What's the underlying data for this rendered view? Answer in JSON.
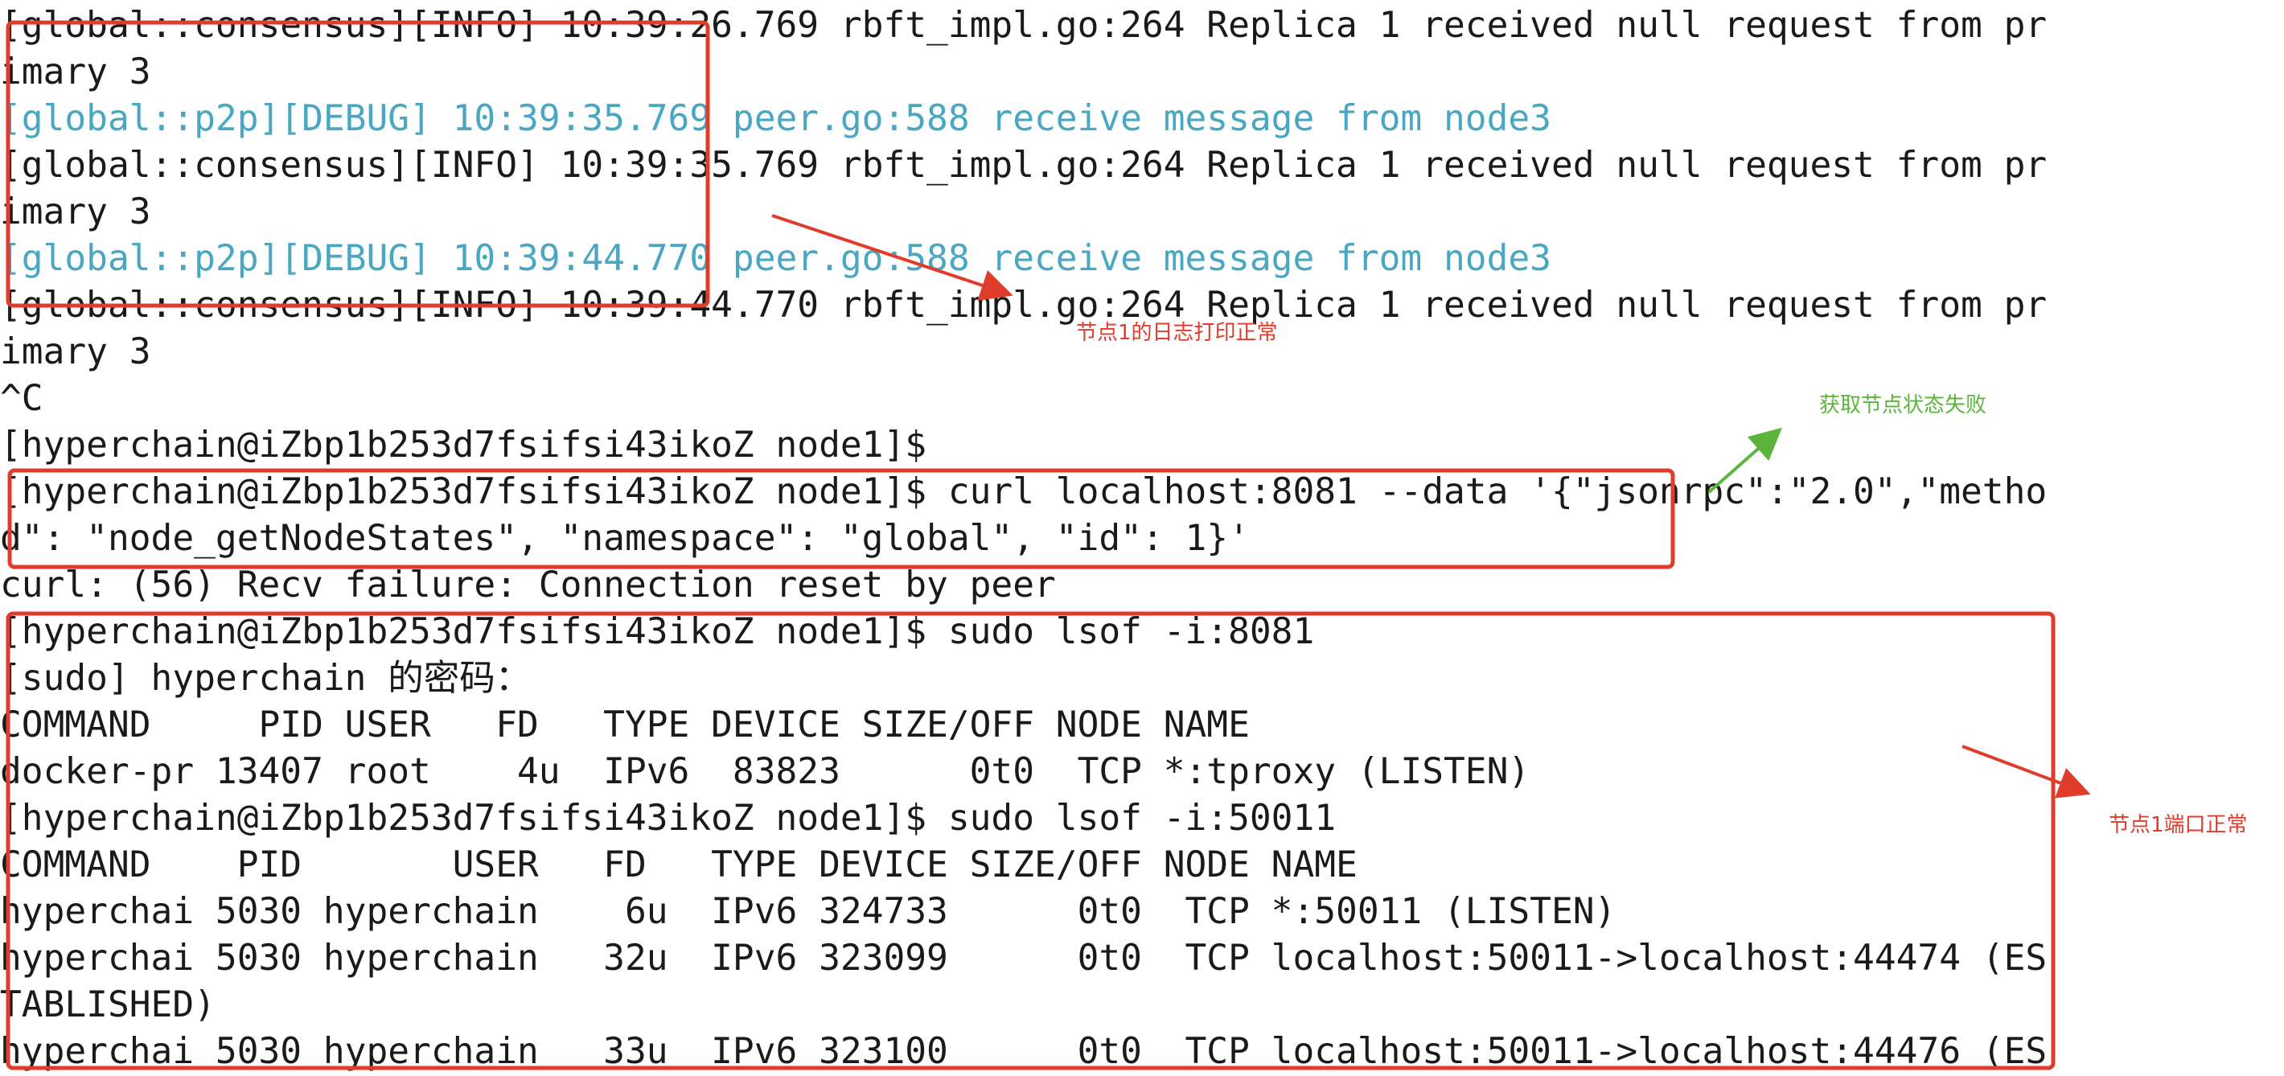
{
  "terminal": {
    "lines": [
      {
        "text": "[global::consensus][INFO] 10:39:26.769 rbft_impl.go:264 Replica 1 received null request from pr",
        "level": "info"
      },
      {
        "text": "imary 3",
        "level": "info"
      },
      {
        "text": "[global::p2p][DEBUG] 10:39:35.769 peer.go:588 receive message from node3",
        "level": "debug"
      },
      {
        "text": "[global::consensus][INFO] 10:39:35.769 rbft_impl.go:264 Replica 1 received null request from pr",
        "level": "info"
      },
      {
        "text": "imary 3",
        "level": "info"
      },
      {
        "text": "[global::p2p][DEBUG] 10:39:44.770 peer.go:588 receive message from node3",
        "level": "debug"
      },
      {
        "text": "[global::consensus][INFO] 10:39:44.770 rbft_impl.go:264 Replica 1 received null request from pr",
        "level": "info"
      },
      {
        "text": "imary 3",
        "level": "info"
      },
      {
        "text": "^C",
        "level": "info"
      },
      {
        "text": "[hyperchain@iZbp1b253d7fsifsi43ikoZ node1]$",
        "level": "prompt"
      },
      {
        "text": "[hyperchain@iZbp1b253d7fsifsi43ikoZ node1]$ curl localhost:8081 --data '{\"jsonrpc\":\"2.0\",\"metho",
        "level": "prompt"
      },
      {
        "text": "d\": \"node_getNodeStates\", \"namespace\": \"global\", \"id\": 1}'",
        "level": "prompt"
      },
      {
        "text": "curl: (56) Recv failure: Connection reset by peer",
        "level": "info"
      },
      {
        "text": "[hyperchain@iZbp1b253d7fsifsi43ikoZ node1]$ sudo lsof -i:8081",
        "level": "prompt"
      },
      {
        "text": "[sudo] hyperchain 的密码：",
        "level": "info"
      },
      {
        "text": "COMMAND     PID USER   FD   TYPE DEVICE SIZE/OFF NODE NAME",
        "level": "info"
      },
      {
        "text": "docker-pr 13407 root    4u  IPv6  83823      0t0  TCP *:tproxy (LISTEN)",
        "level": "info"
      },
      {
        "text": "[hyperchain@iZbp1b253d7fsifsi43ikoZ node1]$ sudo lsof -i:50011",
        "level": "prompt"
      },
      {
        "text": "COMMAND    PID       USER   FD   TYPE DEVICE SIZE/OFF NODE NAME",
        "level": "info"
      },
      {
        "text": "hyperchai 5030 hyperchain    6u  IPv6 324733      0t0  TCP *:50011 (LISTEN)",
        "level": "info"
      },
      {
        "text": "hyperchai 5030 hyperchain   32u  IPv6 323099      0t0  TCP localhost:50011->localhost:44474 (ES",
        "level": "info"
      },
      {
        "text": "TABLISHED)",
        "level": "info"
      },
      {
        "text": "hyperchai 5030 hyperchain   33u  IPv6 323100      0t0  TCP localhost:50011->localhost:44476 (ES",
        "level": "info"
      }
    ]
  },
  "annotations": {
    "log_ok": "节点1的日志打印正常",
    "state_fail": "获取节点状态失败",
    "port_ok": "节点1端口正常"
  },
  "colors": {
    "background": "#ffffff",
    "text": "#1a1a1a",
    "debug": "#4aa7c2",
    "annotation_red": "#e03c2c",
    "annotation_green": "#5bb53b"
  }
}
